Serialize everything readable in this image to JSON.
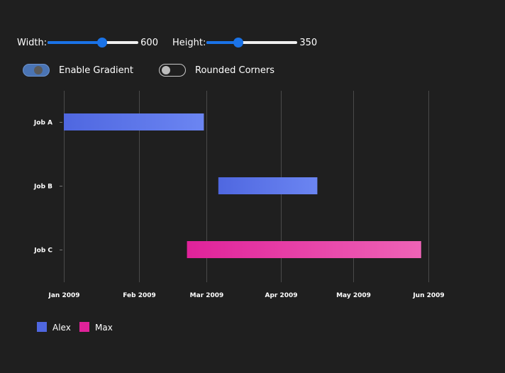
{
  "controls": {
    "width": {
      "label": "Width:",
      "value": "600",
      "fraction": 0.6
    },
    "height": {
      "label": "Height:",
      "value": "350",
      "fraction": 0.35
    },
    "gradient_toggle": {
      "label": "Enable Gradient",
      "on": true
    },
    "rounded_toggle": {
      "label": "Rounded Corners",
      "on": false
    }
  },
  "chart_data": {
    "type": "gantt",
    "title": "",
    "xlabel": "",
    "ylabel": "",
    "grid": true,
    "legend_position": "bottom-left",
    "x_ticks": [
      "Jan 2009",
      "Feb 2009",
      "Mar 2009",
      "Apr 2009",
      "May 2009",
      "Jun 2009"
    ],
    "x_range": [
      "2009-01-01",
      "2009-06-01"
    ],
    "categories": [
      "Job A",
      "Job B",
      "Job C"
    ],
    "tasks": [
      {
        "category": "Job A",
        "start": "2009-01-01",
        "end": "2009-02-28",
        "owner": "Alex"
      },
      {
        "category": "Job B",
        "start": "2009-03-06",
        "end": "2009-04-16",
        "owner": "Alex"
      },
      {
        "category": "Job C",
        "start": "2009-02-21",
        "end": "2009-05-29",
        "owner": "Max"
      }
    ],
    "series": [
      {
        "name": "Alex",
        "color": "#4f67e0",
        "color_end": "#6b85f2"
      },
      {
        "name": "Max",
        "color": "#e0229a",
        "color_end": "#ee63b6"
      }
    ]
  }
}
